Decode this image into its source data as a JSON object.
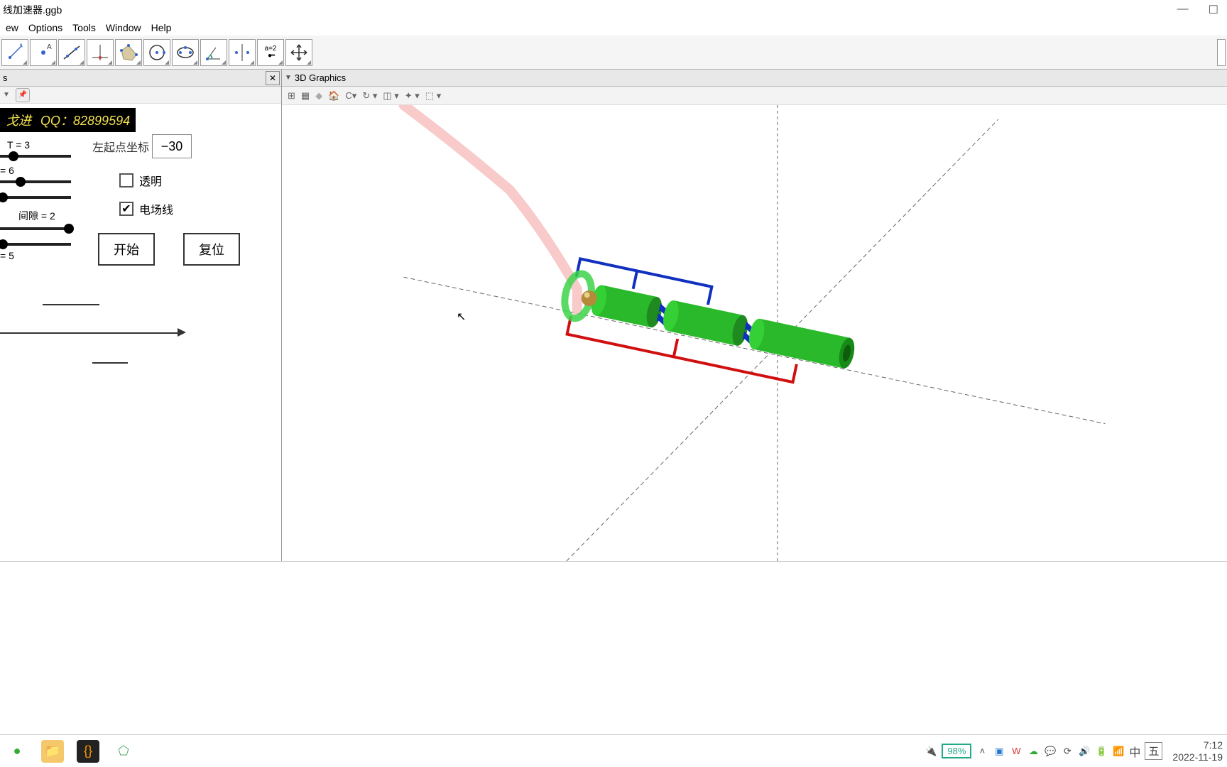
{
  "title": "线加速器.ggb",
  "menu": {
    "view": "ew",
    "options": "Options",
    "tools": "Tools",
    "window": "Window",
    "help": "Help"
  },
  "sidepanel": {
    "header": "s",
    "banner_prefix": "戈进",
    "banner_qq": "QQ：82899594",
    "slider_T": "T = 3",
    "slider_6": "= 6",
    "slider_gap": "间隙 = 2",
    "slider_5": "= 5",
    "start_label_field": "左起点坐标",
    "start_value": "−30",
    "chk_transparent": "透明",
    "chk_fieldlines": "电场线",
    "btn_start": "开始",
    "btn_reset": "复位"
  },
  "view3d": {
    "title": "3D Graphics"
  },
  "tray": {
    "battery": "98%",
    "ime1": "中",
    "ime2": "五",
    "time": "7:12",
    "date": "2022-11-19"
  }
}
